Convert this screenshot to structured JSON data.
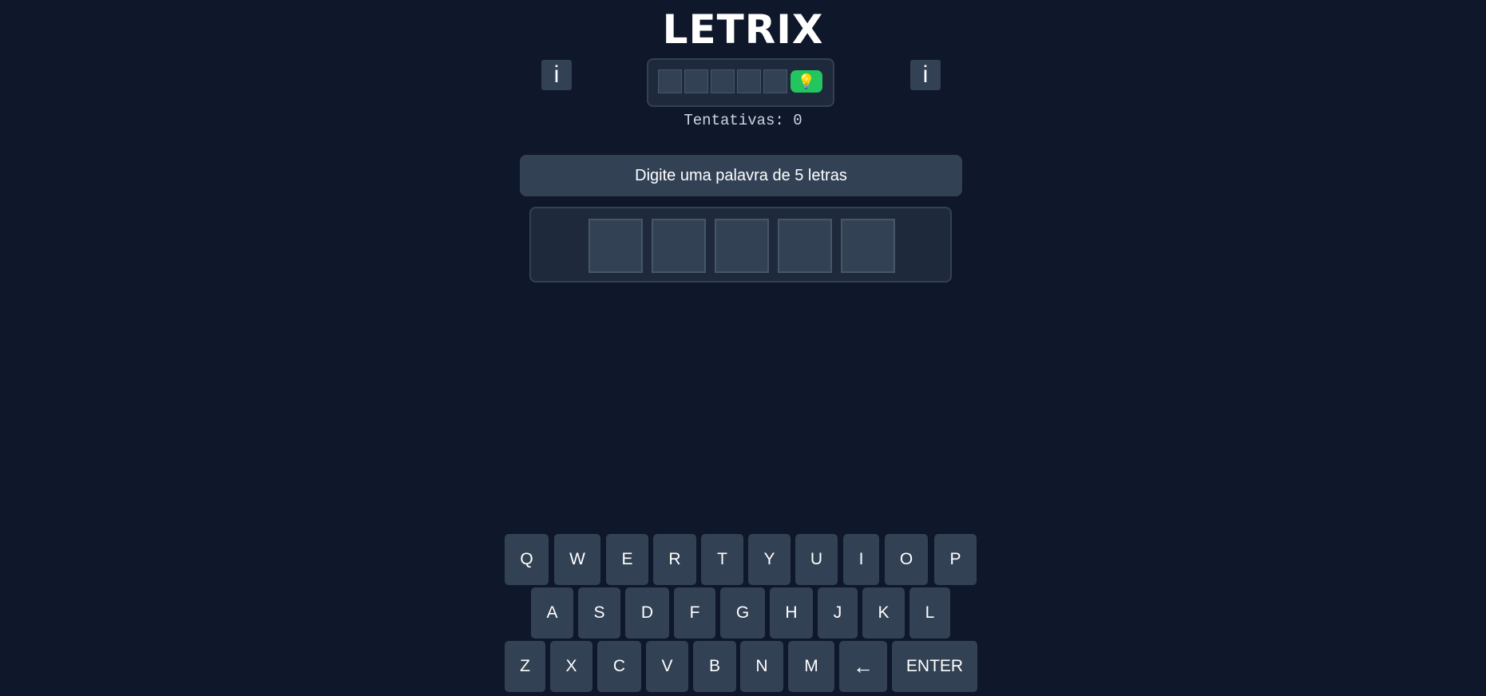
{
  "header": {
    "title": "LETRIX",
    "info_left_label": "i",
    "info_right_label": "i"
  },
  "hint": {
    "slots": [
      "",
      "",
      "",
      "",
      ""
    ],
    "button_icon": "lightbulb-icon",
    "button_glyph": "💡"
  },
  "status": {
    "attempts_text": "Tentativas: 0",
    "message": "Digite uma palavra de 5 letras"
  },
  "board": {
    "tiles": [
      "",
      "",
      "",
      "",
      ""
    ]
  },
  "keyboard": {
    "row1": [
      "Q",
      "W",
      "E",
      "R",
      "T",
      "Y",
      "U",
      "I",
      "O",
      "P"
    ],
    "row2": [
      "A",
      "S",
      "D",
      "F",
      "G",
      "H",
      "J",
      "K",
      "L"
    ],
    "row3": [
      "Z",
      "X",
      "C",
      "V",
      "B",
      "N",
      "M",
      "←",
      "ENTER"
    ]
  },
  "colors": {
    "background": "#0f172a",
    "panel": "#1e293b",
    "key": "#334155",
    "hint_button": "#22c55e"
  }
}
